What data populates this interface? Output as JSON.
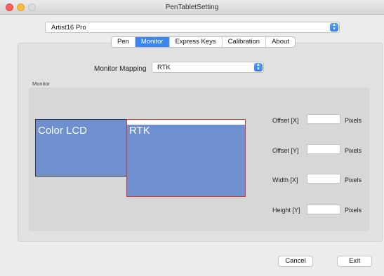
{
  "window": {
    "title": "PenTabletSetting"
  },
  "device": {
    "selected": "Artist16 Pro"
  },
  "tabs": [
    {
      "label": "Pen",
      "active": false
    },
    {
      "label": "Monitor",
      "active": true
    },
    {
      "label": "Express Keys",
      "active": false
    },
    {
      "label": "Calibration",
      "active": false
    },
    {
      "label": "About",
      "active": false
    }
  ],
  "monitor_mapping": {
    "label": "Monitor Mapping",
    "selected": "RTK"
  },
  "monitor_group": {
    "label": "Monitor"
  },
  "screens": [
    {
      "label": "Color LCD"
    },
    {
      "label": "RTK"
    }
  ],
  "fields": [
    {
      "label": "Offset [X]",
      "value": "",
      "unit": "Pixels"
    },
    {
      "label": "Offset [Y]",
      "value": "",
      "unit": "Pixels"
    },
    {
      "label": "Width [X]",
      "value": "",
      "unit": "Pixels"
    },
    {
      "label": "Height [Y]",
      "value": "",
      "unit": "Pixels"
    }
  ],
  "buttons": {
    "cancel": "Cancel",
    "exit": "Exit"
  },
  "colors": {
    "accent": "#3a86f3",
    "screen_fill": "#6e8fd0",
    "selected_border": "#d23a3a"
  }
}
